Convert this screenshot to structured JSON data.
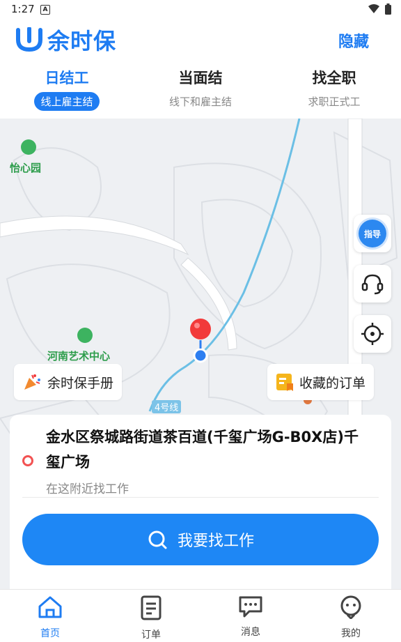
{
  "status_bar": {
    "time": "1:27",
    "a_icon": "A"
  },
  "header": {
    "logo_text": "余时保",
    "hide_label": "隐藏",
    "brand_color": "#1e7cf2"
  },
  "tabs": [
    {
      "title": "日结工",
      "subtitle": "线上雇主结",
      "active": true
    },
    {
      "title": "当面结",
      "subtitle": "线下和雇主结",
      "active": false
    },
    {
      "title": "找全职",
      "subtitle": "求职正式工",
      "active": false
    }
  ],
  "map": {
    "pois": [
      {
        "label": "怡心园"
      },
      {
        "label": "河南艺术中心"
      }
    ],
    "road_label": "4号线",
    "side_buttons": [
      {
        "icon": "guide-icon",
        "label": "指导"
      },
      {
        "icon": "headset-icon"
      },
      {
        "icon": "locate-icon"
      }
    ],
    "handbook_label": "余时保手册",
    "favorites_label": "收藏的订单"
  },
  "location_card": {
    "address": "金水区祭城路街道茶百道(千玺广场G-B0X店)千玺广场",
    "hint": "在这附近找工作",
    "find_button": "我要找工作"
  },
  "bottom_nav": [
    {
      "label": "首页",
      "icon": "home-icon",
      "active": true
    },
    {
      "label": "订单",
      "icon": "order-icon",
      "active": false
    },
    {
      "label": "消息",
      "icon": "message-icon",
      "active": false
    },
    {
      "label": "我的",
      "icon": "profile-icon",
      "active": false
    }
  ]
}
